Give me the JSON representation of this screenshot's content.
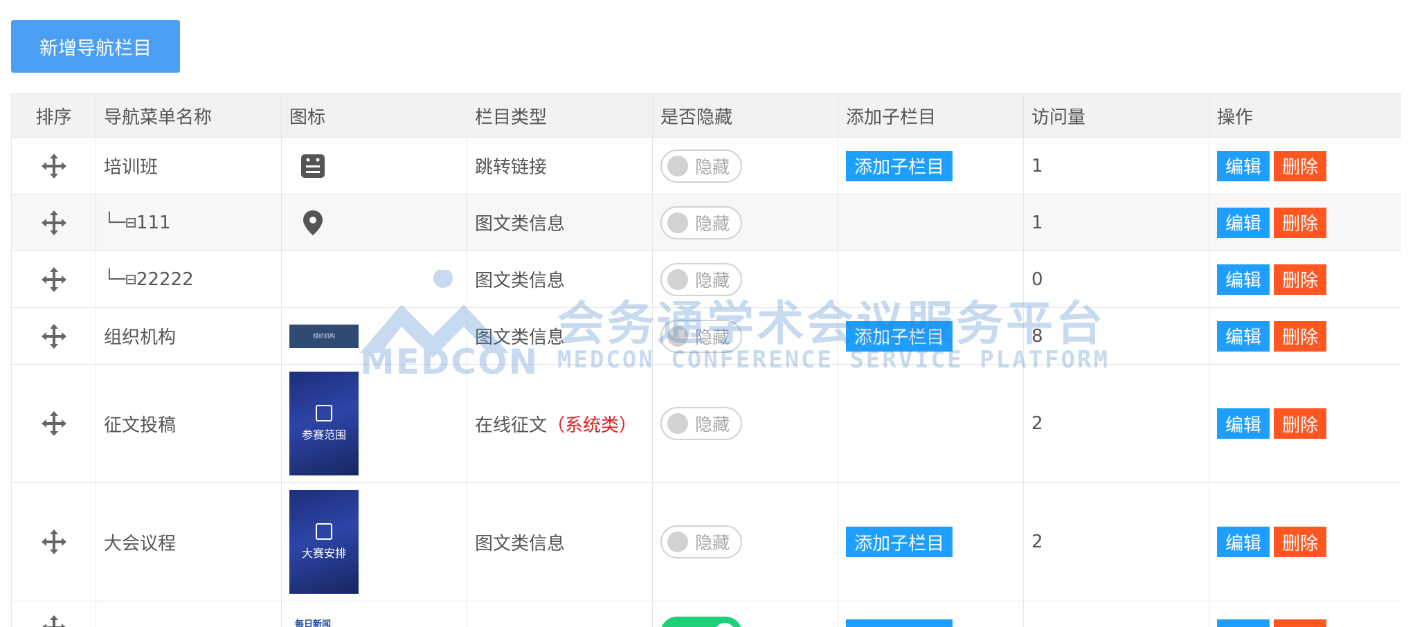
{
  "toolbar": {
    "add_button": "新增导航栏目"
  },
  "table": {
    "headers": [
      "排序",
      "导航菜单名称",
      "图标",
      "栏目类型",
      "是否隐藏",
      "添加子栏目",
      "访问量",
      "操作"
    ],
    "rows": [
      {
        "name": "培训班",
        "prefix": "",
        "icon": "document-list-icon",
        "type": "跳转链接",
        "type_tag": "",
        "hidden_label": "隐藏",
        "hidden": false,
        "add_child": "添加子栏目",
        "visits": "1",
        "edit": "编辑",
        "delete": "删除"
      },
      {
        "name": "111",
        "prefix": "└─⊟",
        "icon": "location-pin-icon",
        "type": "图文类信息",
        "type_tag": "",
        "hidden_label": "隐藏",
        "hidden": false,
        "add_child": "",
        "visits": "1",
        "edit": "编辑",
        "delete": "删除"
      },
      {
        "name": "22222",
        "prefix": "└─⊟",
        "icon": "",
        "type": "图文类信息",
        "type_tag": "",
        "hidden_label": "隐藏",
        "hidden": false,
        "add_child": "",
        "visits": "0",
        "edit": "编辑",
        "delete": "删除"
      },
      {
        "name": "组织机构",
        "prefix": "",
        "icon": "banner-thumb",
        "icon_text": "组织机构",
        "type": "图文类信息",
        "type_tag": "",
        "hidden_label": "隐藏",
        "hidden": false,
        "add_child": "添加子栏目",
        "visits": "8",
        "edit": "编辑",
        "delete": "删除"
      },
      {
        "name": "征文投稿",
        "prefix": "",
        "icon": "tall-thumb",
        "icon_text": "参赛范围",
        "type": "在线征文",
        "type_tag": "（系统类）",
        "hidden_label": "隐藏",
        "hidden": false,
        "add_child": "",
        "visits": "2",
        "edit": "编辑",
        "delete": "删除"
      },
      {
        "name": "大会议程",
        "prefix": "",
        "icon": "tall-thumb",
        "icon_text": "大赛安排",
        "type": "图文类信息",
        "type_tag": "",
        "hidden_label": "隐藏",
        "hidden": false,
        "add_child": "添加子栏目",
        "visits": "2",
        "edit": "编辑",
        "delete": "删除"
      },
      {
        "name": "",
        "prefix": "",
        "icon": "small-thumb",
        "icon_text": "每日新闻",
        "type": "",
        "type_tag": "",
        "hidden_label": "",
        "hidden": true,
        "add_child": "",
        "visits": "",
        "edit": "",
        "delete": ""
      }
    ]
  },
  "watermark": {
    "cn": "会务通学术会议服务平台",
    "en": "MEDCON CONFERENCE SERVICE PLATFORM",
    "logo": "MEDCON"
  },
  "colors": {
    "primary": "#1e9fff",
    "danger": "#ff5722",
    "add_button": "#4a9ff5",
    "system_tag": "#e02020",
    "toggle_on": "#1fcf7a"
  }
}
